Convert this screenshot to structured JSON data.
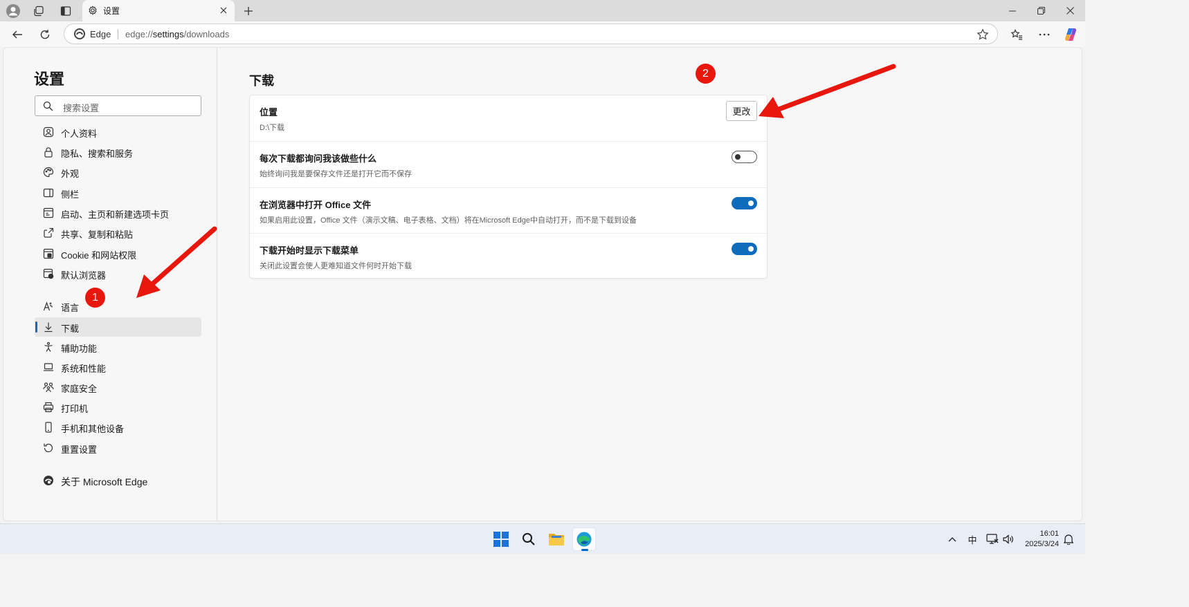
{
  "browser": {
    "tab_title": "设置",
    "address_label": "Edge",
    "url_prefix": "edge://",
    "url_path": "settings",
    "url_suffix": "/downloads"
  },
  "sidebar": {
    "title": "设置",
    "search_placeholder": "搜索设置",
    "items": [
      {
        "label": "个人资料",
        "icon": "profile-icon"
      },
      {
        "label": "隐私、搜索和服务",
        "icon": "lock-icon"
      },
      {
        "label": "外观",
        "icon": "palette-icon"
      },
      {
        "label": "侧栏",
        "icon": "sidebar-icon"
      },
      {
        "label": "启动、主页和新建选项卡页",
        "icon": "home-tab-icon"
      },
      {
        "label": "共享、复制和粘贴",
        "icon": "share-icon"
      },
      {
        "label": "Cookie 和网站权限",
        "icon": "cookie-icon"
      },
      {
        "label": "默认浏览器",
        "icon": "browser-icon"
      },
      {
        "label": "语言",
        "icon": "language-icon"
      },
      {
        "label": "下载",
        "icon": "download-icon",
        "active": true
      },
      {
        "label": "辅助功能",
        "icon": "accessibility-icon"
      },
      {
        "label": "系统和性能",
        "icon": "laptop-icon"
      },
      {
        "label": "家庭安全",
        "icon": "family-icon"
      },
      {
        "label": "打印机",
        "icon": "printer-icon"
      },
      {
        "label": "手机和其他设备",
        "icon": "phone-icon"
      },
      {
        "label": "重置设置",
        "icon": "reset-icon"
      }
    ],
    "about_label": "关于 Microsoft Edge"
  },
  "main": {
    "title": "下载",
    "rows": [
      {
        "title": "位置",
        "desc": "D:\\下载",
        "control": "button",
        "button_label": "更改"
      },
      {
        "title": "每次下载都询问我该做些什么",
        "desc": "始终询问我是要保存文件还是打开它而不保存",
        "control": "toggle",
        "on": false
      },
      {
        "title": "在浏览器中打开 Office 文件",
        "desc": "如果启用此设置，Office 文件（演示文稿、电子表格、文档）将在Microsoft Edge中自动打开，而不是下载到设备",
        "control": "toggle",
        "on": true
      },
      {
        "title": "下载开始时显示下载菜单",
        "desc": "关闭此设置会使人更难知道文件何时开始下载",
        "control": "toggle",
        "on": true
      }
    ]
  },
  "annotations": {
    "badge1": "1",
    "badge2": "2",
    "color": "#e8170d"
  },
  "taskbar": {
    "tray_ime": "中",
    "time": "16:01",
    "date": "2025/3/24"
  },
  "colors": {
    "accent": "#0f6cbd",
    "annotation_red": "#e8170d"
  }
}
